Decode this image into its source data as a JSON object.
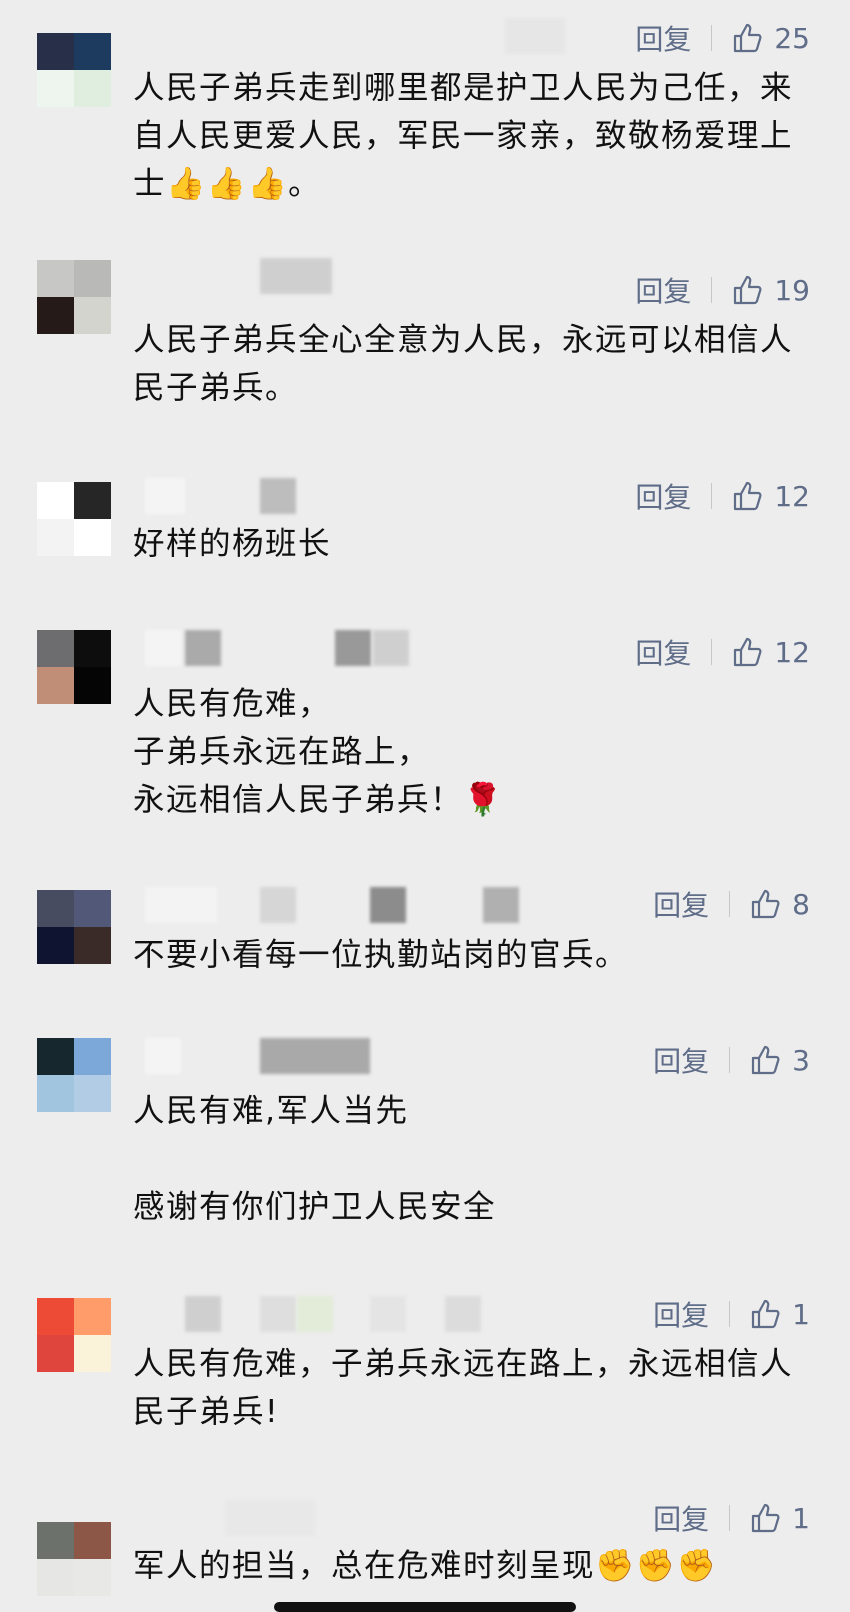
{
  "comments": [
    {
      "reply_label": "回复",
      "likes": "25",
      "text": "人民子弟兵走到哪里都是护卫人民为己任，来自人民更爱人民，军民一家亲，致敬杨爱理上士👍👍👍。",
      "avatar_colors": [
        "#273048",
        "#1d3b5e",
        "#eef4ee",
        "#dfeedf"
      ]
    },
    {
      "reply_label": "回复",
      "likes": "19",
      "text": "人民子弟兵全心全意为人民，永远可以相信人民子弟兵。",
      "avatar_colors": [
        "#c7c7c5",
        "#b9b9b7",
        "#261a19",
        "#d4d4ce"
      ]
    },
    {
      "reply_label": "回复",
      "likes": "12",
      "text": "好样的杨班长",
      "avatar_colors": [
        "#ffffff",
        "#262626",
        "#f3f3f3",
        "#ffffff"
      ]
    },
    {
      "reply_label": "回复",
      "likes": "12",
      "text": "人民有危难，\n子弟兵永远在路上，\n永远相信人民子弟兵！🌹",
      "avatar_colors": [
        "#6d6c6e",
        "#0d0d0e",
        "#c08e77",
        "#050505"
      ]
    },
    {
      "reply_label": "回复",
      "likes": "8",
      "text": "不要小看每一位执勤站岗的官兵。",
      "avatar_colors": [
        "#474c61",
        "#525978",
        "#0f1430",
        "#3a2a28"
      ]
    },
    {
      "reply_label": "回复",
      "likes": "3",
      "text": "人民有难,军人当先\n\n感谢有你们护卫人民安全",
      "avatar_colors": [
        "#16282e",
        "#7ca8d9",
        "#a1c5de",
        "#b2cce6"
      ]
    },
    {
      "reply_label": "回复",
      "likes": "1",
      "text": "人民有危难，子弟兵永远在路上，永远相信人民子弟兵!",
      "avatar_colors": [
        "#ee4b36",
        "#ff9c6a",
        "#e0453d",
        "#fbf2da"
      ]
    },
    {
      "reply_label": "回复",
      "likes": "1",
      "text": "军人的担当，总在危难时刻呈现✊✊✊",
      "avatar_colors": [
        "#6c726b",
        "#8d5748",
        "#e6e6e4",
        "#e8e8e6"
      ]
    }
  ]
}
